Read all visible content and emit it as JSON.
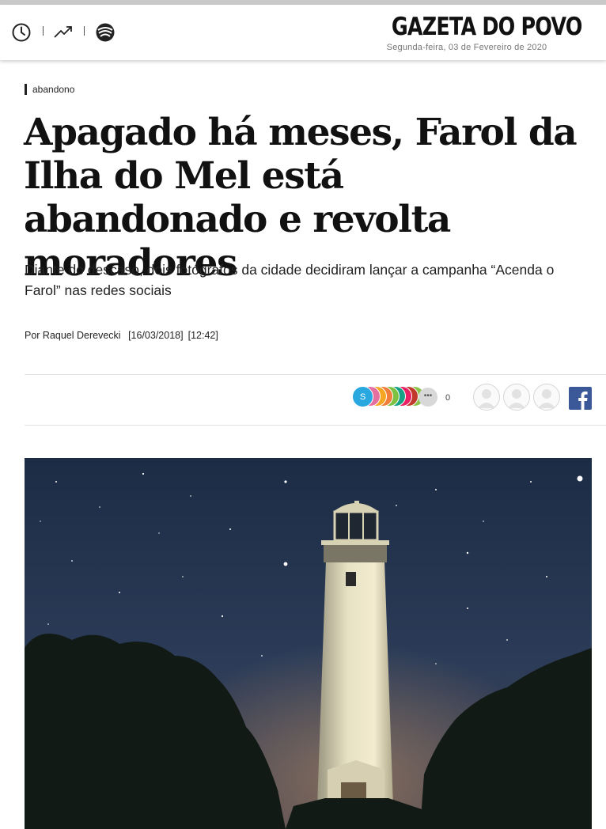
{
  "header": {
    "logo": "GAZETA DO POVO",
    "date": "Segunda-feira, 03 de Fevereiro de 2020",
    "icons": [
      "clock-icon",
      "trending-icon",
      "gazeta-icon"
    ]
  },
  "article": {
    "tag": "abandono",
    "headline": "Apagado há meses, Farol da Ilha do Mel está abandonado e revolta moradores",
    "subtitle": "Diante do descaso, dois fotógrafos da cidade decidiram lançar a campanha “Acenda o Farol” nas redes sociais",
    "byline": {
      "author": "Por Raquel Derevecki",
      "date": "[16/03/2018]",
      "time": "[12:42]"
    }
  },
  "social": {
    "reaction_letter": "S",
    "reaction_more": "•••",
    "reaction_count": "0",
    "reaction_colors": [
      "#29a8e0",
      "#f5a623",
      "#f07d3a",
      "#7cc142",
      "#16a085",
      "#e91e63",
      "#c0392b",
      "#8bc34a"
    ],
    "facebook_icon": "facebook-icon"
  },
  "photo": {
    "subject": "lighthouse-night-photo"
  }
}
